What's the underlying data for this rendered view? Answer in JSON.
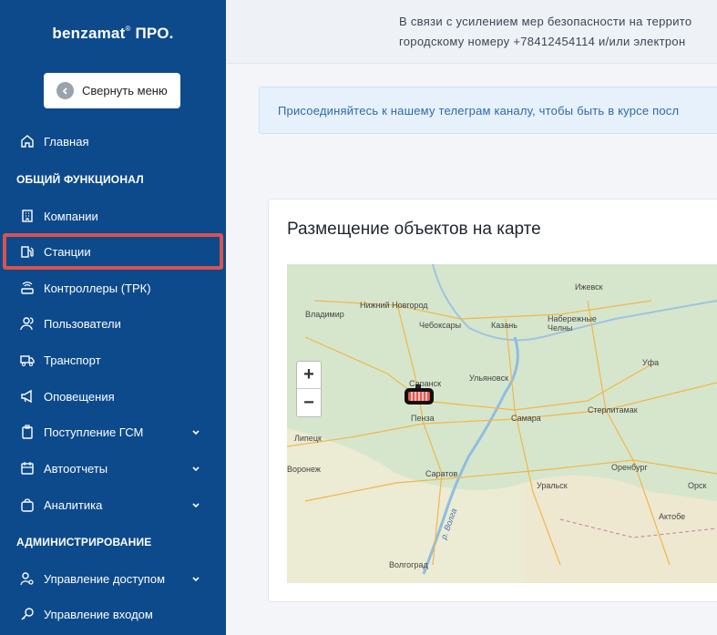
{
  "brand": {
    "name": "benzamat",
    "mark": "®",
    "suffix": " ПРО."
  },
  "collapse_button": {
    "label": "Свернуть меню",
    "icon": "arrow-left-circle-icon"
  },
  "sidebar": {
    "items": [
      {
        "label": "Главная",
        "icon": "home-icon"
      },
      {
        "section": "ОБЩИЙ ФУНКЦИОНАЛ"
      },
      {
        "label": "Компании",
        "icon": "building-icon"
      },
      {
        "label": "Станции",
        "icon": "fuel-pump-icon",
        "active": true
      },
      {
        "label": "Контроллеры (ТРК)",
        "icon": "router-icon"
      },
      {
        "label": "Пользователи",
        "icon": "users-icon"
      },
      {
        "label": "Транспорт",
        "icon": "truck-icon"
      },
      {
        "label": "Оповещения",
        "icon": "megaphone-icon"
      },
      {
        "label": "Поступление ГСМ",
        "icon": "clipboard-icon",
        "expandable": true
      },
      {
        "label": "Автоотчеты",
        "icon": "calendar-icon",
        "expandable": true
      },
      {
        "label": "Аналитика",
        "icon": "bag-icon",
        "expandable": true
      },
      {
        "section": "АДМИНИСТРИРОВАНИЕ"
      },
      {
        "label": "Управление доступом",
        "icon": "user-settings-icon",
        "expandable": true
      },
      {
        "label": "Управление входом",
        "icon": "key-icon"
      }
    ]
  },
  "topbar": {
    "line1": "В связи с усилением мер безопасности на террито",
    "line2": "городскому номеру +78412454114 и/или электрон"
  },
  "notice": {
    "text": "Присоединяйтесь к нашему телеграм каналу, чтобы быть в курсе посл"
  },
  "map_card": {
    "title": "Размещение объектов на карте",
    "zoom_in": "+",
    "zoom_out": "−",
    "cities": [
      "Ижевск",
      "Нижний Новгород",
      "Владимир",
      "Чебоксары",
      "Казань",
      "Набережные Челны",
      "Уфа",
      "Ульяновск",
      "Саранск",
      "Пенза",
      "Самара",
      "Стерлитамак",
      "Липецк",
      "Воронеж",
      "Саратов",
      "Оренбург",
      "Уральск",
      "Орск",
      "Актобе",
      "Волгоград",
      "р. Волга"
    ]
  },
  "colors": {
    "sidebar": "#0d4a8c",
    "highlight": "#d9534f",
    "notice_text": "#2f6aa8"
  }
}
